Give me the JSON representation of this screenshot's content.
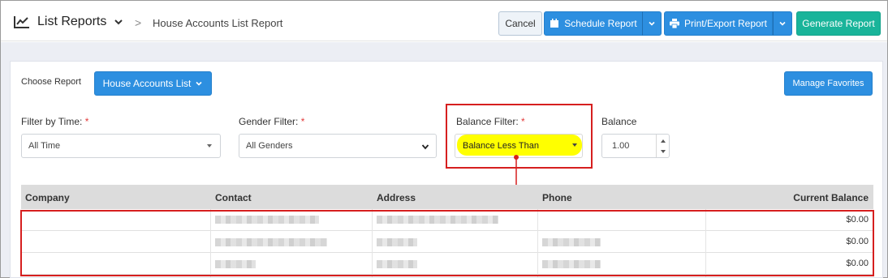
{
  "header": {
    "title": "List Reports",
    "subtitle": "House Accounts List Report",
    "separator": ">"
  },
  "toolbar": {
    "cancel_label": "Cancel",
    "schedule_label": "Schedule Report",
    "print_label": "Print/Export Report",
    "generate_label": "Generate Report"
  },
  "choose_report": {
    "label": "Choose Report",
    "button_label": "House Accounts List",
    "manage_label": "Manage Favorites"
  },
  "filters": {
    "time_label": "Filter by Time:",
    "time_value": "All Time",
    "gender_label": "Gender Filter:",
    "gender_value": "All Genders",
    "balance_filter_label": "Balance Filter:",
    "balance_filter_value": "Balance Less Than",
    "balance_label": "Balance",
    "balance_value": "1.00",
    "required_mark": "*"
  },
  "table": {
    "columns": [
      "Company",
      "Contact",
      "Address",
      "Phone",
      "Current Balance"
    ],
    "rows": [
      {
        "balance": "$0.00"
      },
      {
        "balance": "$0.00"
      },
      {
        "balance": "$0.00"
      }
    ]
  },
  "colors": {
    "primary": "#2d8fe0",
    "success": "#19b49a",
    "annotation": "#d61f1f",
    "highlight": "#ffff00"
  }
}
